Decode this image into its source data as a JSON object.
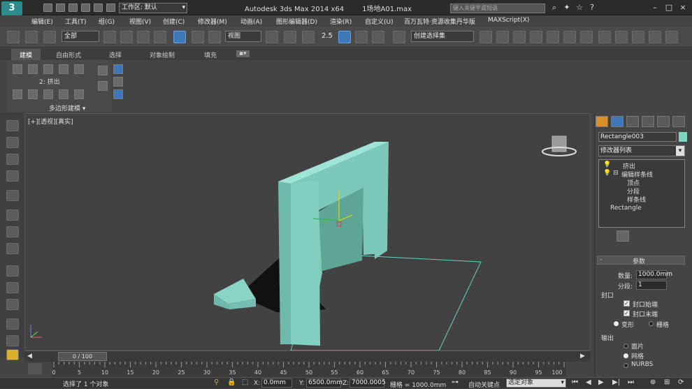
{
  "title": {
    "app": "Autodesk 3ds Max  2014 x64",
    "file": "1场地A01.max",
    "workspace": "工作区: 默认",
    "search": "键入关键字或短语"
  },
  "menu": [
    "编辑(E)",
    "工具(T)",
    "组(G)",
    "视图(V)",
    "创建(C)",
    "修改器(M)",
    "动画(A)",
    "图形编辑器(D)",
    "渲染(R)",
    "自定义(U)",
    "百万瓦特·资源收集丹华版",
    "MAXScript(X)"
  ],
  "toolbar": {
    "filter": "全部",
    "refcoord": "视图",
    "snap_pct": "2.5",
    "selset": "创建选择集"
  },
  "ribbon": {
    "tabs": [
      "建模",
      "自由形式",
      "选择",
      "对象绘制",
      "填充"
    ],
    "sublabel": "2: 挤出",
    "group": "多边形建模 ▾"
  },
  "viewport": {
    "label": "[+][透视][真实]"
  },
  "cmd": {
    "objname": "Rectangle003",
    "modlist": "修改器列表",
    "stack": [
      {
        "icon": "💡",
        "label": "挤出"
      },
      {
        "icon": "💡 ⊟",
        "label": "编辑样条线"
      },
      {
        "label": "顶点"
      },
      {
        "label": "分段"
      },
      {
        "label": "样条线"
      },
      {
        "label": "Rectangle"
      }
    ],
    "params_title": "参数",
    "amount_label": "数量:",
    "amount": "1000.0mm",
    "segs_label": "分段:",
    "segs": "1",
    "cap_title": "封口",
    "cap_start": "封口始端",
    "cap_end": "封口末端",
    "morph": "变形",
    "grid": "栅格",
    "output_title": "输出",
    "patch": "面片",
    "mesh": "网格",
    "nurbs": "NURBS"
  },
  "timeline": {
    "frame": "0 / 100",
    "ticks": [
      "0",
      "5",
      "10",
      "15",
      "20",
      "25",
      "30",
      "35",
      "40",
      "45",
      "50",
      "55",
      "60",
      "65",
      "70",
      "75",
      "80",
      "85",
      "90",
      "95",
      "100"
    ]
  },
  "status": {
    "selected": "选择了 1 个对象",
    "x_label": "X:",
    "x": "0.0mm",
    "y_label": "Y:",
    "y": "6500.0mm",
    "z_label": "Z:",
    "z": "7000.0005",
    "grid": "栅格 = 1000.0mm",
    "autokey": "自动关键点",
    "selobj": "选定对象"
  }
}
